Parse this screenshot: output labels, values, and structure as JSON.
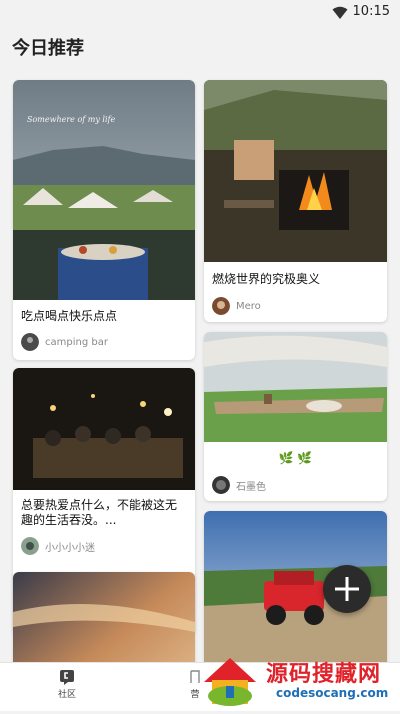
{
  "status_bar": {
    "time": "10:15",
    "wifi_icon": "wifi-icon"
  },
  "header": {
    "title": "今日推荐"
  },
  "cards": [
    {
      "title": "吃点喝点快乐点点",
      "user": "camping bar",
      "image_script": "Somewhere of my life"
    },
    {
      "title": "燃烧世界的究极奥义",
      "user": "Mero"
    },
    {
      "title": "总要热爱点什么，不能被这无趣的生活吞没。...",
      "user": "小小小小迷"
    },
    {
      "title": "🌿 🌿",
      "user": "石墨色"
    },
    {
      "title": "",
      "user": ""
    },
    {
      "title": "",
      "user": ""
    }
  ],
  "fab": {
    "icon": "plus-icon"
  },
  "tabbar": {
    "tabs": [
      {
        "label": "社区",
        "icon": "community-icon"
      },
      {
        "label": "营",
        "icon": "camp-icon"
      }
    ]
  },
  "watermark": {
    "text": "源码搜藏网",
    "sub": "codesocang.com"
  },
  "colors": {
    "background": "#f2f2f2",
    "fab": "#2b2b2b",
    "watermark_red": "#e0232a",
    "watermark_blue": "#1f6fb5"
  }
}
